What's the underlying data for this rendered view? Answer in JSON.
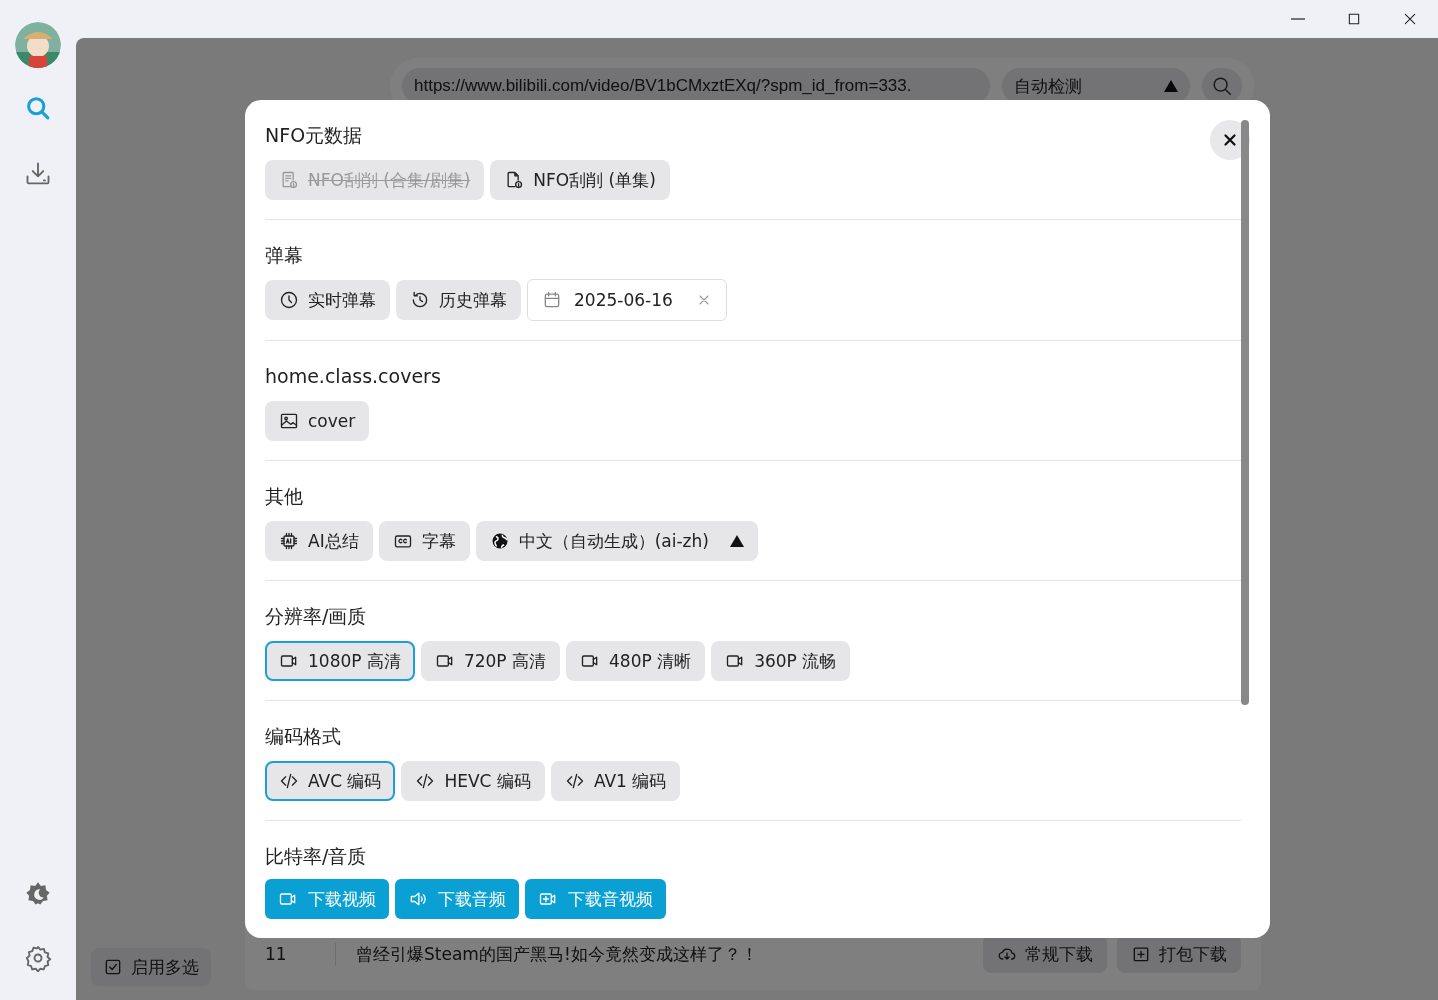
{
  "sidebar": {
    "items": [
      {
        "kind": "search",
        "selected": true
      },
      {
        "kind": "download",
        "selected": false
      }
    ]
  },
  "search_bar": {
    "url": "https://www.bilibili.com/video/BV1bCMxztEXq/?spm_id_from=333.",
    "mode": "自动检测"
  },
  "multi_select": {
    "label": "启用多选"
  },
  "video_list": [
    {
      "index": "11",
      "title": "曾经引爆Steam的国产黑马!如今竟然变成这样了？！",
      "actions": [
        {
          "label": "常规下载",
          "kind": "cloud"
        },
        {
          "label": "打包下载",
          "kind": "package"
        }
      ]
    }
  ],
  "dialog": {
    "sections": [
      {
        "title": "NFO元数据",
        "options": [
          {
            "kind": "doc-list",
            "label": "NFO刮削 (合集/剧集)",
            "disabled": true
          },
          {
            "kind": "doc",
            "label": "NFO刮削 (单集)",
            "disabled": false
          }
        ]
      },
      {
        "title": "弹幕",
        "options": [
          {
            "kind": "clock",
            "label": "实时弹幕"
          },
          {
            "kind": "history",
            "label": "历史弹幕"
          },
          {
            "kind": "date",
            "value": "2025-06-16"
          }
        ]
      },
      {
        "title": "home.class.covers",
        "options": [
          {
            "kind": "image",
            "label": "cover"
          }
        ]
      },
      {
        "title": "其他",
        "options": [
          {
            "kind": "chip",
            "label": "AI总结"
          },
          {
            "kind": "cc",
            "label": "字幕"
          },
          {
            "kind": "select",
            "label": "中文（自动生成）(ai-zh)"
          }
        ]
      },
      {
        "title": "分辨率/画质",
        "options": [
          {
            "kind": "video",
            "label": "1080P 高清",
            "selected": true
          },
          {
            "kind": "video",
            "label": "720P 高清",
            "selected": false
          },
          {
            "kind": "video",
            "label": "480P 清晰",
            "selected": false
          },
          {
            "kind": "video",
            "label": "360P 流畅",
            "selected": false
          }
        ]
      },
      {
        "title": "编码格式",
        "options": [
          {
            "kind": "code",
            "label": "AVC 编码",
            "selected": true
          },
          {
            "kind": "code",
            "label": "HEVC 编码",
            "selected": false
          },
          {
            "kind": "code",
            "label": "AV1 编码",
            "selected": false
          }
        ]
      },
      {
        "title": "比特率/音质"
      }
    ],
    "actions": [
      {
        "kind": "video",
        "label": "下载视频"
      },
      {
        "kind": "audio",
        "label": "下载音频"
      },
      {
        "kind": "video-plus",
        "label": "下载音视频"
      }
    ]
  }
}
